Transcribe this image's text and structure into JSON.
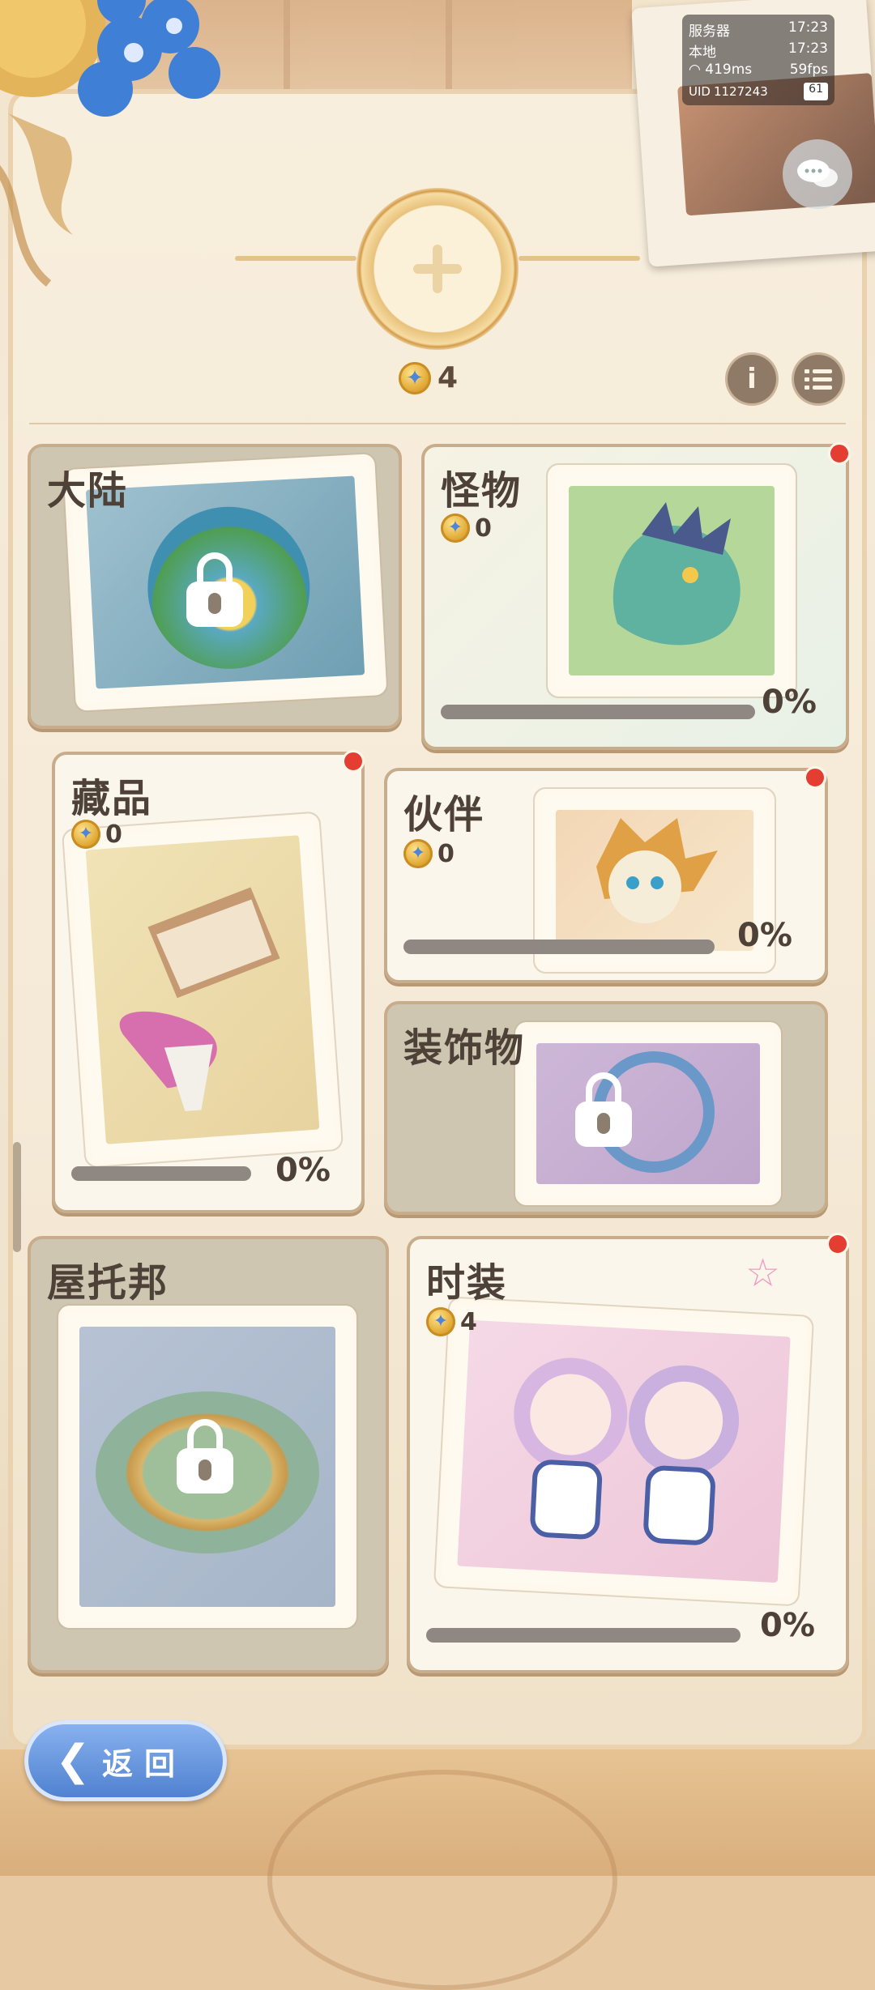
{
  "status": {
    "server_label": "服务器",
    "server_time": "17:23",
    "local_label": "本地",
    "local_time": "17:23",
    "ping": "419ms",
    "fps": "59fps",
    "uid_label": "UID",
    "uid": "1127243",
    "battery": "61"
  },
  "total_coins": "4",
  "colors": {
    "accent": "#4d7fcf",
    "red_dot": "#e43d32",
    "bar": "#8f8882"
  },
  "cards": {
    "continent": {
      "title": "大陆",
      "locked": true
    },
    "monster": {
      "title": "怪物",
      "count": "0",
      "progress": "0%",
      "new": true
    },
    "collection": {
      "title": "藏品",
      "count": "0",
      "progress": "0%",
      "new": true
    },
    "partner": {
      "title": "伙伴",
      "count": "0",
      "progress": "0%",
      "new": true
    },
    "decoration": {
      "title": "装饰物",
      "locked": true
    },
    "utopia": {
      "title": "屋托邦",
      "locked": true
    },
    "fashion": {
      "title": "时装",
      "count": "4",
      "progress": "0%",
      "new": true
    }
  },
  "back_button": {
    "label": "返回"
  },
  "icons": [
    "plus-icon",
    "coin-icon",
    "info-icon",
    "list-icon",
    "chat-icon",
    "lock-icon",
    "back-arrow-icon",
    "wifi-icon"
  ]
}
